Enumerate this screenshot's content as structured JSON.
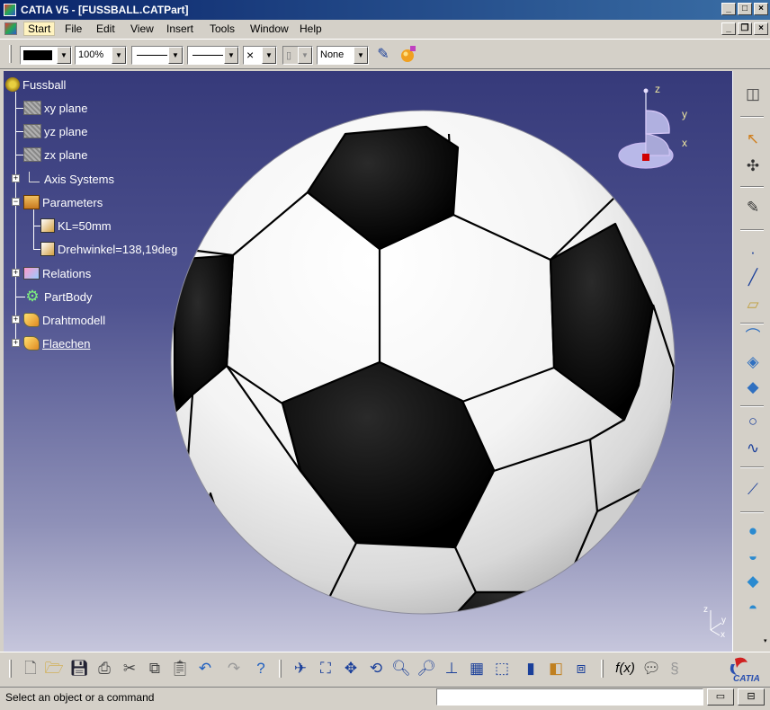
{
  "window": {
    "title": "CATIA V5 - [FUSSBALL.CATPart]",
    "controls": [
      "_",
      "□",
      "×"
    ],
    "mdi_controls": [
      "_",
      "❐",
      "×"
    ]
  },
  "menu": {
    "items": [
      "Start",
      "File",
      "Edit",
      "View",
      "Insert",
      "Tools",
      "Window",
      "Help"
    ],
    "active": "Start"
  },
  "graphic_properties": {
    "color": "black",
    "transparency": "100%",
    "linetype_arrow": "▼",
    "point_symbol": "×",
    "layer": "None"
  },
  "tree": {
    "root": "Fussball",
    "nodes": [
      {
        "label": "xy plane",
        "icon": "plane-icon"
      },
      {
        "label": "yz plane",
        "icon": "plane-icon"
      },
      {
        "label": "zx plane",
        "icon": "plane-icon"
      },
      {
        "label": "Axis Systems",
        "icon": "axis-system-icon",
        "expandable": true
      },
      {
        "label": "Parameters",
        "icon": "parameters-icon",
        "expandable": true,
        "expanded": true
      },
      {
        "label": "KL=50mm",
        "icon": "length-parameter-icon"
      },
      {
        "label": "Drehwinkel=138,19deg",
        "icon": "angle-parameter-icon"
      },
      {
        "label": "Relations",
        "icon": "relations-icon",
        "expandable": true
      },
      {
        "label": "PartBody",
        "icon": "partbody-icon"
      },
      {
        "label": "Drahtmodell",
        "icon": "geometrical-set-icon",
        "expandable": true
      },
      {
        "label": "Flaechen",
        "icon": "geometrical-set-icon",
        "expandable": true,
        "underlined": true
      }
    ]
  },
  "compass": {
    "axis_x": "x",
    "axis_y": "y",
    "axis_z": "z"
  },
  "triad": {
    "axis_x": "x",
    "axis_y": "y",
    "axis_z": "z"
  },
  "workbench_toolbar": {
    "icons": [
      "sketcher-icon",
      "select-arrow-icon",
      "snap-icon",
      "sketch-edit-icon",
      "point-icon",
      "line-icon",
      "plane-icon",
      "extrude-surface-icon",
      "sweep-surface-icon",
      "multi-section-surface-icon",
      "circle-icon",
      "spline-icon",
      "law-icon",
      "sphere-icon",
      "offset-surface-icon",
      "fill-surface-icon",
      "blend-surface-icon"
    ]
  },
  "standard_toolbar": {
    "icons": [
      "new-file-icon",
      "open-file-icon",
      "save-icon",
      "print-icon",
      "cut-icon",
      "copy-icon",
      "paste-icon",
      "undo-icon",
      "redo-icon",
      "whats-this-icon",
      "fly-mode-icon",
      "fit-all-icon",
      "pan-icon",
      "rotate-icon",
      "zoom-in-icon",
      "zoom-out-icon",
      "normal-view-icon",
      "multi-view-icon",
      "iso-view-icon",
      "shading-icon",
      "hide-show-icon",
      "swap-space-icon",
      "formula-icon",
      "comment-icon",
      "knowledge-icon",
      "catia-logo-icon"
    ],
    "logo_text": "CATIA",
    "formula_label": "f(x)"
  },
  "statusbar": {
    "message": "Select an object or a command",
    "command_input": ""
  },
  "colors": {
    "background_top": "#363a7a",
    "background_bottom": "#c6c6dc",
    "tree_text": "#ffffff",
    "ball_black": "#000000",
    "ball_white": "#ffffff"
  }
}
